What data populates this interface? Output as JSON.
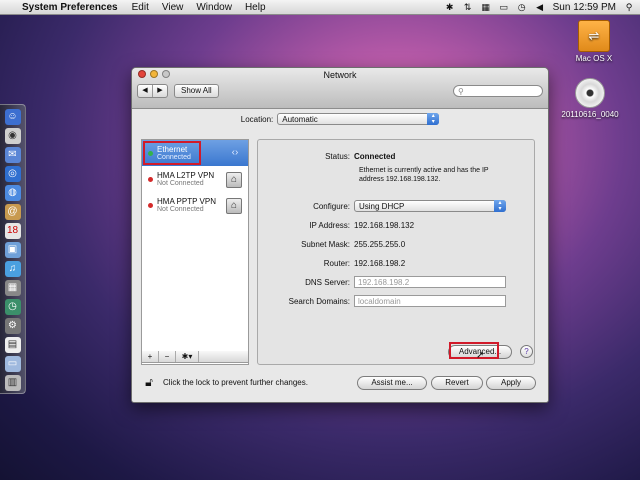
{
  "menubar": {
    "app_name": "System Preferences",
    "menus": [
      "Edit",
      "View",
      "Window",
      "Help"
    ],
    "clock": "Sun 12:59 PM"
  },
  "desktop": {
    "icons": [
      {
        "label": "Mac OS X",
        "icon": "hard-drive-icon"
      },
      {
        "label": "20110616_0040",
        "icon": "dvd-disc-icon"
      }
    ]
  },
  "window": {
    "title": "Network",
    "show_all_label": "Show All",
    "search_placeholder": ""
  },
  "location": {
    "label": "Location:",
    "value": "Automatic"
  },
  "services": [
    {
      "name": "Ethernet",
      "status": "Connected",
      "dot_color": "#34b34a",
      "selected": true
    },
    {
      "name": "HMA L2TP VPN",
      "status": "Not Connected",
      "dot_color": "#d42a2a",
      "selected": false
    },
    {
      "name": "HMA PPTP VPN",
      "status": "Not Connected",
      "dot_color": "#d42a2a",
      "selected": false
    }
  ],
  "sidebar_controls": {
    "add": "+",
    "remove": "−",
    "action": "✱▾"
  },
  "detail": {
    "status_label": "Status:",
    "status_value": "Connected",
    "status_description_line1": "Ethernet is currently active and has the IP",
    "status_description_line2": "address 192.168.198.132.",
    "configure_label": "Configure:",
    "configure_value": "Using DHCP",
    "ip_label": "IP Address:",
    "ip_value": "192.168.198.132",
    "subnet_label": "Subnet Mask:",
    "subnet_value": "255.255.255.0",
    "router_label": "Router:",
    "router_value": "192.168.198.2",
    "dns_label": "DNS Server:",
    "dns_value": "192.168.198.2",
    "search_domains_label": "Search Domains:",
    "search_domains_value": "localdomain",
    "advanced_label": "Advanced...",
    "help_label": "?"
  },
  "footer": {
    "lock_text": "Click the lock to prevent further changes.",
    "assist_label": "Assist me...",
    "revert_label": "Revert",
    "apply_label": "Apply"
  },
  "colors": {
    "selection": "#3a77cf",
    "connected_dot": "#34b34a",
    "disconnected_dot": "#d42a2a",
    "highlight_box": "#d11a2a"
  }
}
